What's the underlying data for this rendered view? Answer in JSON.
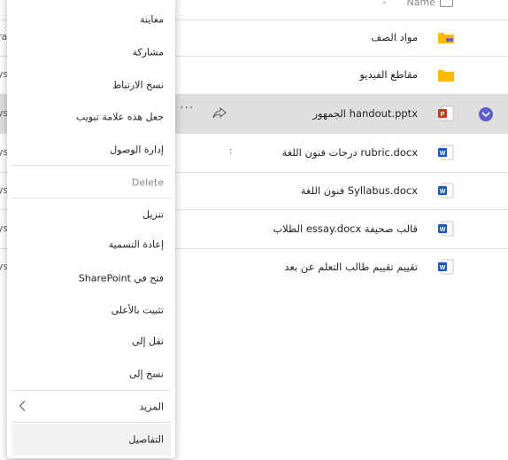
{
  "header": {
    "name_label": "Name"
  },
  "files": [
    {
      "name": "مواد الصف",
      "type": "folder-shared",
      "left_fragment": "ra"
    },
    {
      "name": "مقاطع الفيديو",
      "type": "folder",
      "left_fragment": "ys"
    },
    {
      "name": "handout.pptx الجمهور",
      "type": "pptx",
      "left_fragment": "ys",
      "selected": true
    },
    {
      "name": "rubric.docx درجات فنون اللغة",
      "type": "docx",
      "left_fragment": "ys"
    },
    {
      "name": "Syllabus.docx فنون اللغة",
      "type": "docx",
      "left_fragment": "ys"
    },
    {
      "name": "قالب صحيفة essay.docx الطلاب",
      "type": "docx",
      "left_fragment": "ys"
    },
    {
      "name": "تقييم تقييم طالب التعلم عن بعد",
      "type": "docx",
      "left_fragment": "ys"
    }
  ],
  "menu": {
    "items": [
      {
        "label": "معاينة"
      },
      {
        "label": "مشاركة"
      },
      {
        "label": "نسخ الارتباط"
      },
      {
        "label": "جعل هذه علامة تبويب"
      },
      {
        "label": "إدارة الوصول"
      },
      {
        "label": "Delete",
        "disabled": true
      },
      {
        "label": "تنزيل"
      },
      {
        "label": "إعادة التسمية"
      },
      {
        "label": "فتح في SharePoint"
      },
      {
        "label": "تثبيت بالأعلى"
      },
      {
        "label": "نقل إلى"
      },
      {
        "label": "نسخ إلى"
      },
      {
        "label": "المزيد",
        "submenu": true
      },
      {
        "label": "التفاصيل",
        "hover": true
      }
    ]
  },
  "colors": {
    "accent": "#5b5fc7",
    "folder": "#ffb900",
    "word": "#185abd",
    "powerpoint": "#c43e1c",
    "selected_row": "#e1dfdd"
  },
  "icons": {
    "folder": "folder-icon",
    "shared_folder": "shared-folder-icon",
    "word": "word-file-icon",
    "powerpoint": "powerpoint-file-icon",
    "share": "share-icon",
    "more": "more-options-icon",
    "chevron": "chevron-left-icon",
    "check": "checkmark-icon"
  }
}
